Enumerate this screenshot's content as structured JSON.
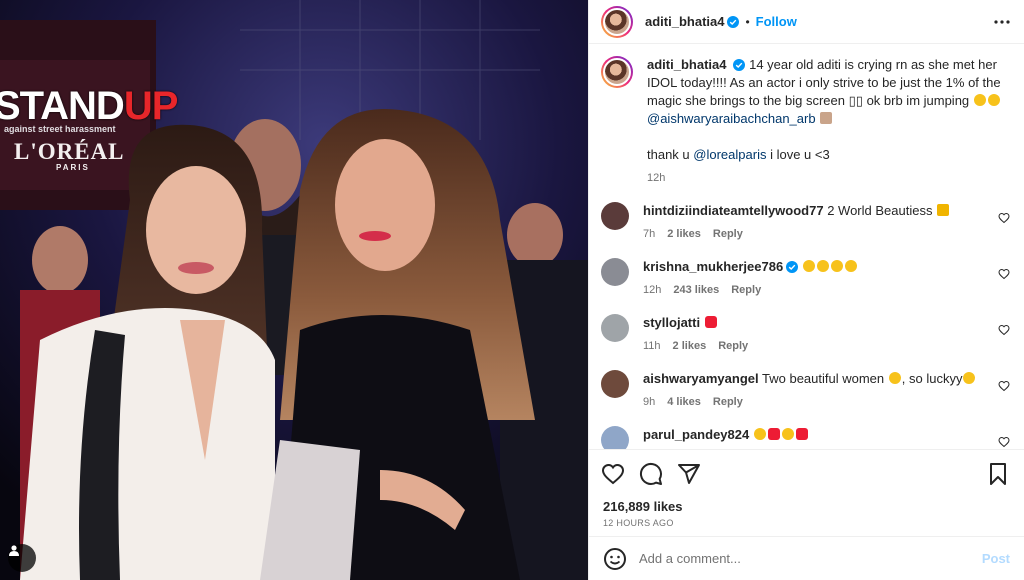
{
  "photo": {
    "banner": {
      "standup_a": "STAND",
      "standup_b": "UP",
      "subline": "against street harassment",
      "brand": "L'ORÉAL",
      "city": "PARIS"
    }
  },
  "header": {
    "username": "aditi_bhatia4",
    "separator": "•",
    "follow_label": "Follow"
  },
  "caption": {
    "username": "aditi_bhatia4",
    "text_1": "14 year old aditi is crying rn as she met her IDOL today!!!! As an actor i only strive to be just the 1% of the magic she brings to the big screen",
    "text_2": "ok brb im jumping",
    "mention_1": "@aishwaryaraibachchan_arb",
    "thanks_prefix": "thank u",
    "mention_2": "@lorealparis",
    "thanks_suffix": "i love u <3",
    "time": "12h"
  },
  "comments": [
    {
      "username": "hintdiziindiateamtellywood77",
      "text": "2 World Beautiess",
      "time": "7h",
      "likes": "2 likes",
      "reply": "Reply",
      "avatar_color": "#5a3b3a",
      "emojis": [
        "crown"
      ]
    },
    {
      "username": "krishna_mukherjee786",
      "text": "",
      "time": "12h",
      "likes": "243 likes",
      "reply": "Reply",
      "avatar_color": "#8a8c94",
      "verified": true,
      "emojis": [
        "heart-eyes",
        "heart-eyes",
        "heart-eyes",
        "heart-eyes"
      ]
    },
    {
      "username": "styllojatti",
      "text": "",
      "time": "11h",
      "likes": "2 likes",
      "reply": "Reply",
      "avatar_color": "#9fa4a8",
      "emojis": [
        "red-heart"
      ]
    },
    {
      "username": "aishwaryamyangel",
      "text": "Two beautiful women",
      "text_2": ", so luckyy",
      "time": "9h",
      "likes": "4 likes",
      "reply": "Reply",
      "avatar_color": "#6e4a3c",
      "emojis": [
        "heart-eyes"
      ],
      "emojis_2": [
        "face-savoring"
      ]
    },
    {
      "username": "parul_pandey824",
      "text": "",
      "time": "",
      "likes": "",
      "reply": "",
      "avatar_color": "#8fa6c8",
      "emojis": [
        "heart-eyes",
        "red-heart",
        "heart-eyes",
        "red-heart"
      ]
    }
  ],
  "likes_count": "216,889 likes",
  "posted_time": "12 HOURS AGO",
  "add_comment": {
    "placeholder": "Add a comment...",
    "post_label": "Post"
  },
  "colors": {
    "accent": "#0095f6",
    "verified": "#0095f6",
    "post_disabled": "#b3dbff",
    "heart": "#ed4956",
    "emoji_yellow": "#f7c21b"
  },
  "icons": {
    "like": "heart-icon",
    "comment": "comment-icon",
    "share": "share-icon",
    "save": "bookmark-icon",
    "emoji": "smiley-icon",
    "more": "more-icon",
    "tagged": "user-tag-icon"
  }
}
